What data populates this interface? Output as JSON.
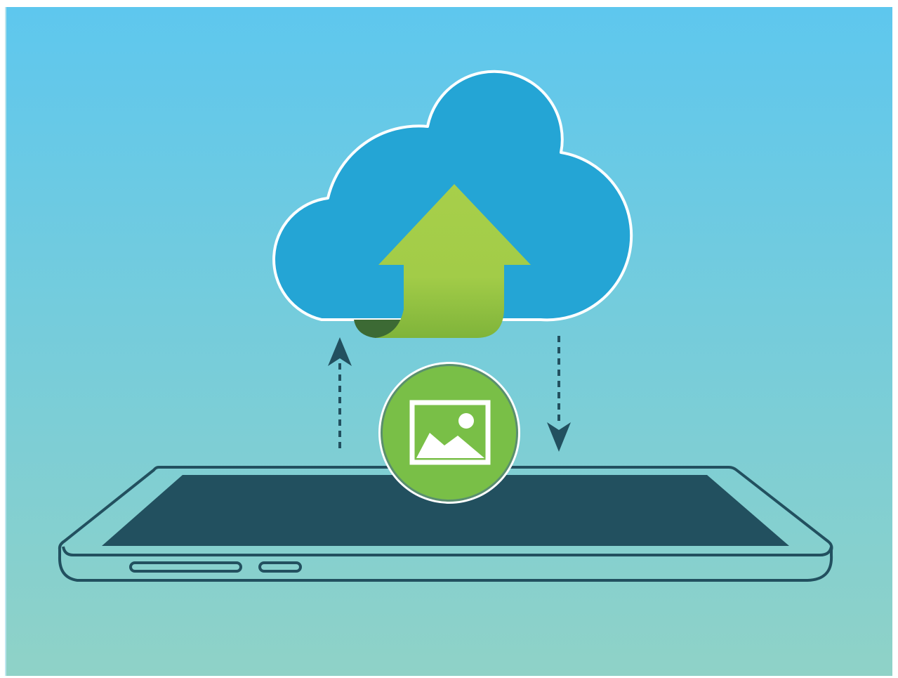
{
  "illustration": {
    "cloud": {
      "icon": "cloud-icon"
    },
    "upload_arrow": {
      "icon": "upload-arrow-icon"
    },
    "image_badge": {
      "icon": "image-icon"
    },
    "sync_arrows": {
      "up_icon": "dashed-arrow-up-icon",
      "down_icon": "dashed-arrow-down-icon"
    },
    "device": {
      "icon": "tablet-icon"
    }
  },
  "colors": {
    "background_top": "#5ec7ee",
    "background_bottom": "#8fd2c7",
    "cloud_fill": "#24a5d5",
    "cloud_stroke": "#ffffff",
    "arrow_top": "#a7cf4a",
    "arrow_bottom": "#7fb43a",
    "arrow_fold": "#3c6a34",
    "badge_fill": "#79bf47",
    "badge_ring": "#5a8f6e",
    "device_line": "#22505f",
    "device_screen": "#22505f",
    "white": "#ffffff"
  }
}
